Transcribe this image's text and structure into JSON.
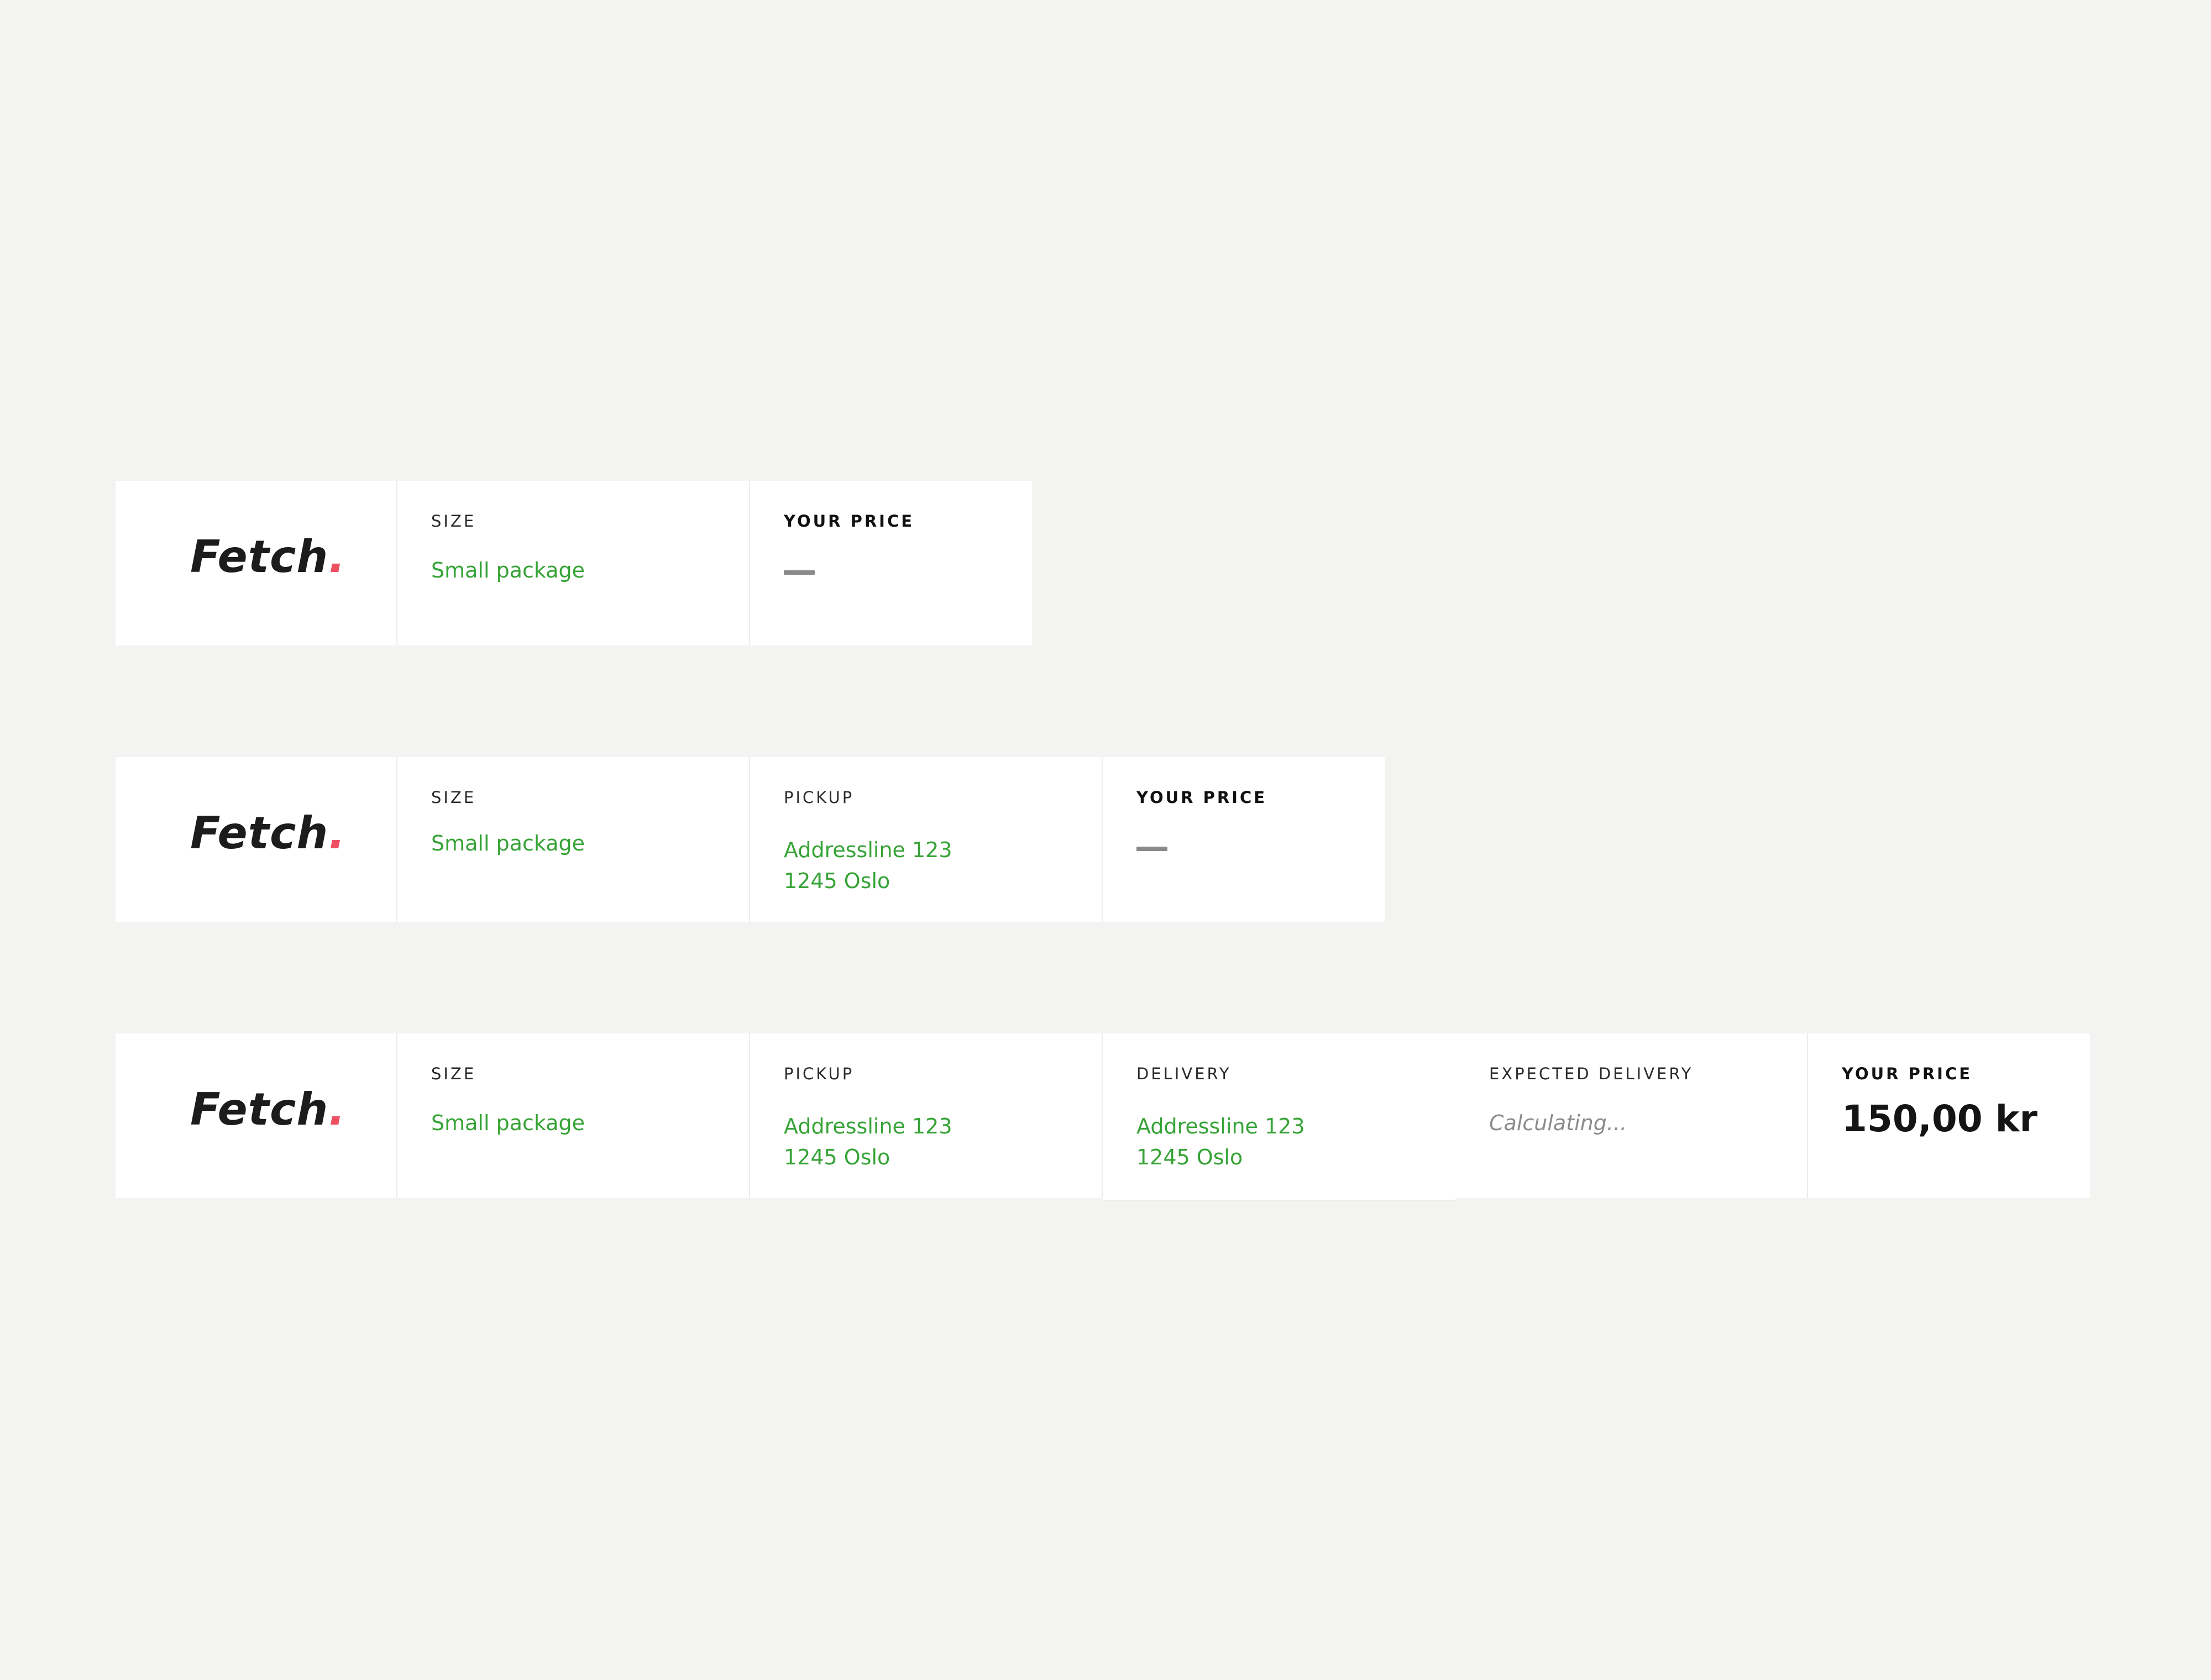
{
  "brand": {
    "name": "Fetch",
    "dot": ".",
    "dot_color": "#ee4f62",
    "text_color": "#1c1c1c"
  },
  "colors": {
    "background": "#f3f3f2",
    "card": "#ffffff",
    "value_green": "#36a336",
    "muted": "#8b8b8b"
  },
  "bars": [
    {
      "size": {
        "label": "SIZE",
        "value": "Small package"
      },
      "price": {
        "label": "YOUR PRICE",
        "placeholder": "—"
      }
    },
    {
      "size": {
        "label": "SIZE",
        "value": "Small package"
      },
      "pickup": {
        "label": "PICKUP",
        "line1": "Addressline 123",
        "line2": "1245 Oslo"
      },
      "price": {
        "label": "YOUR PRICE",
        "placeholder": "—"
      }
    },
    {
      "size": {
        "label": "SIZE",
        "value": "Small package"
      },
      "pickup": {
        "label": "PICKUP",
        "line1": "Addressline 123",
        "line2": "1245 Oslo"
      },
      "delivery": {
        "label": "DELIVERY",
        "line1": "Addressline 123",
        "line2": "1245 Oslo"
      },
      "expected": {
        "label": "EXPECTED DELIVERY",
        "value": "Calculating..."
      },
      "price": {
        "label": "YOUR PRICE",
        "value": "150,00 kr"
      }
    }
  ]
}
